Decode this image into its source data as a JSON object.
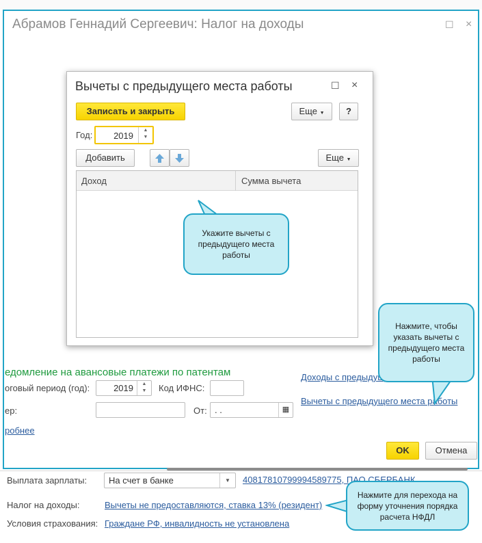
{
  "main_window": {
    "title": "Абрамов Геннадий Сергеевич: Налог на доходы",
    "section_heading": "едомление на авансовые платежи по патентам",
    "period_label": "оговый период (год):",
    "period_value": "2019",
    "ifns_label": "Код ИФНС:",
    "ifns_value": "",
    "number_label": "ер:",
    "number_value": "",
    "from_label": "От:",
    "from_value": ".  .",
    "more_link": "робнее",
    "income_prev_link": "Доходы с предыдущ",
    "deductions_prev_link": "Вычеты с предыдущего места работы",
    "ok_label": "OK",
    "cancel_label": "Отмена"
  },
  "bottom_form": {
    "salary_label": "Выплата зарплаты:",
    "salary_value": "На счет в банке",
    "account_link": "40817810799994589775, ПАО СБЕРБАНК",
    "tax_label": "Налог на доходы:",
    "tax_link": "Вычеты не предоставляются, ставка 13% (резидент)",
    "insurance_label": "Условия страхования:",
    "insurance_link": "Граждане РФ, инвалидность не установлена"
  },
  "dialog": {
    "title": "Вычеты с предыдущего места работы",
    "save_close_label": "Записать и закрыть",
    "more_label": "Еще",
    "help_label": "?",
    "year_label": "Год:",
    "year_value": "2019",
    "add_label": "Добавить",
    "table_more_label": "Еще",
    "columns": [
      "Доход",
      "Сумма вычета"
    ]
  },
  "callouts": {
    "table_hint": "Укажите вычеты с предыдущего места работы",
    "link_hint": "Нажмите, чтобы указать вычеты с предыдущего места работы",
    "tax_hint": "Нажмите для перехода на форму уточнения порядка расчета НФДЛ"
  },
  "colors": {
    "accent": "#22a4c7",
    "callout_fill": "#c7eef5",
    "primary_button": "#f7d300",
    "section_heading": "#1e9a3e",
    "link": "#2b5c9e"
  },
  "icons": {
    "maximize": "square",
    "close": "×",
    "up_arrow": "arrow-up",
    "down_arrow": "arrow-down",
    "calendar": "calendar",
    "dropdown": "triangle-down"
  }
}
